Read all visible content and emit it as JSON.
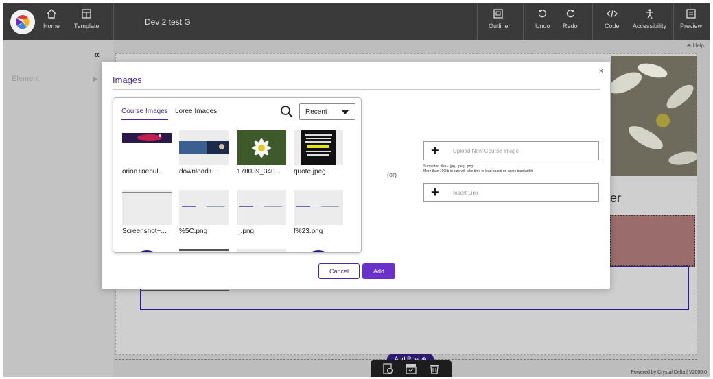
{
  "app": {
    "title": "Dev 2 test G",
    "colors": {
      "topbar": "#3a3a3a",
      "accent": "#4b2a9a",
      "primary_button": "#6a31c9"
    }
  },
  "toolbar_left": [
    {
      "label": "Home",
      "icon": "home-icon"
    },
    {
      "label": "Template",
      "icon": "template-icon"
    }
  ],
  "toolbar_right": [
    {
      "label": "Outline",
      "icon": "outline-icon"
    },
    {
      "label": "Undo",
      "icon": "undo-icon"
    },
    {
      "label": "Redo",
      "icon": "redo-icon"
    },
    {
      "label": "Code",
      "icon": "code-icon"
    },
    {
      "label": "Accessibility",
      "icon": "accessibility-icon"
    },
    {
      "label": "Preview",
      "icon": "preview-icon"
    }
  ],
  "sidebar": {
    "collapse_glyph": "«",
    "element_label": "Element",
    "element_arrow": "▶"
  },
  "help": {
    "label": "⊕ Help"
  },
  "canvas": {
    "heading_fragment": "er",
    "add_row_label": "Add Row"
  },
  "footer": {
    "powered_by": "Powered by Crystal Delta  |  V2000.0"
  },
  "modal": {
    "title": "Images",
    "close_glyph": "×",
    "tabs": [
      {
        "label": "Course Images",
        "active": true
      },
      {
        "label": "Loree Images",
        "active": false
      }
    ],
    "sort": {
      "selected": "Recent"
    },
    "images": [
      {
        "label": "orion+nebul...",
        "kind": "nebula"
      },
      {
        "label": "download+...",
        "kind": "banner"
      },
      {
        "label": "178039_340...",
        "kind": "daisy"
      },
      {
        "label": "quote.jpeg",
        "kind": "quote"
      },
      {
        "label": "Screenshot+...",
        "kind": "screenshot"
      },
      {
        "label": "%5C.png",
        "kind": "page"
      },
      {
        "label": "_.png",
        "kind": "page"
      },
      {
        "label": "f%23.png",
        "kind": "page"
      }
    ],
    "or_text": "(or)",
    "upload_label": "Upload New Course Image",
    "supported_line1": "Supported files - .jpg, .jpeg, .png.",
    "supported_line2": "More than 100kb in size will take time to load based on users bandwidth",
    "insert_link_label": "Insert Link",
    "cancel_label": "Cancel",
    "add_label": "Add"
  }
}
